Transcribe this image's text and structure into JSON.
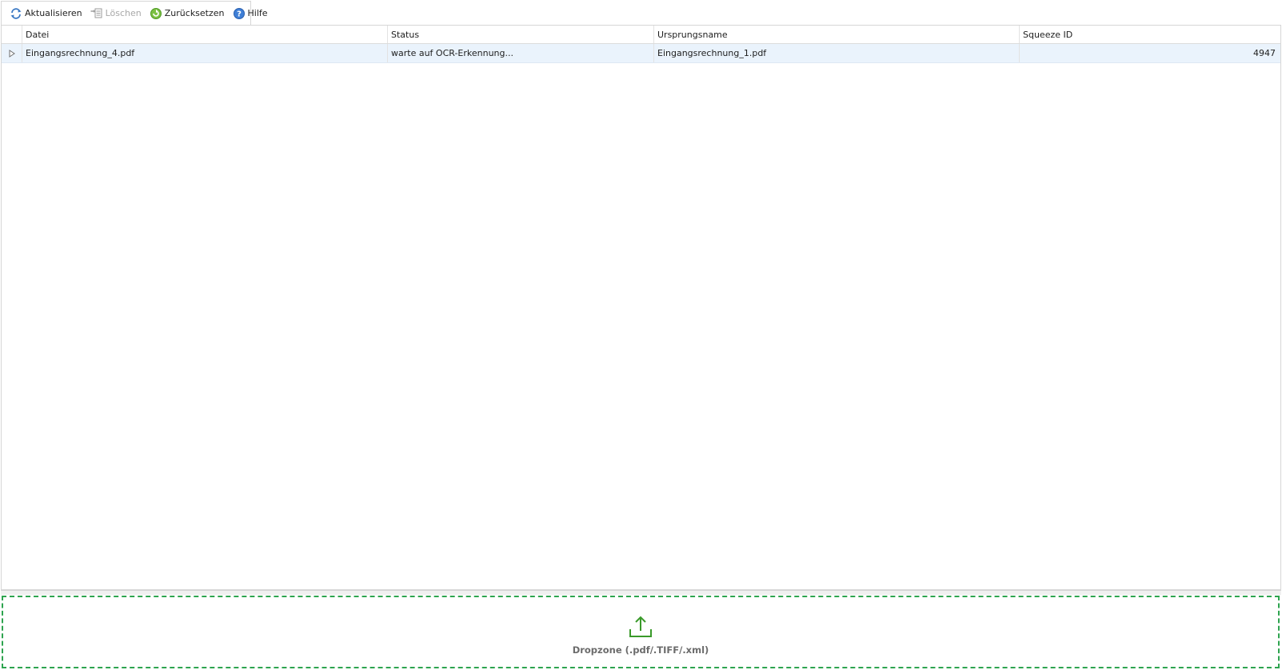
{
  "toolbar": {
    "refresh": {
      "label": "Aktualisieren",
      "icon": "refresh-icon",
      "enabled": true
    },
    "delete": {
      "label": "Löschen",
      "icon": "delete-icon",
      "enabled": false
    },
    "reset": {
      "label": "Zurücksetzen",
      "icon": "reset-icon",
      "enabled": true
    },
    "help": {
      "label": "Hilfe",
      "icon": "help-icon",
      "enabled": true
    }
  },
  "grid": {
    "columns": [
      "Datei",
      "Status",
      "Ursprungsname",
      "Squeeze ID"
    ],
    "rows": [
      {
        "datei": "Eingangsrechnung_4.pdf",
        "status": "warte auf OCR-Erkennung...",
        "ursprungsname": "Eingangsrechnung_1.pdf",
        "squeeze_id": "4947",
        "selected": true
      }
    ]
  },
  "dropzone": {
    "label": "Dropzone (.pdf/.TIFF/.xml)",
    "icon": "upload-icon"
  },
  "colors": {
    "accent_green": "#2ea44f",
    "row_selected": "#eaf3fc",
    "help_blue": "#2a6fcf"
  }
}
